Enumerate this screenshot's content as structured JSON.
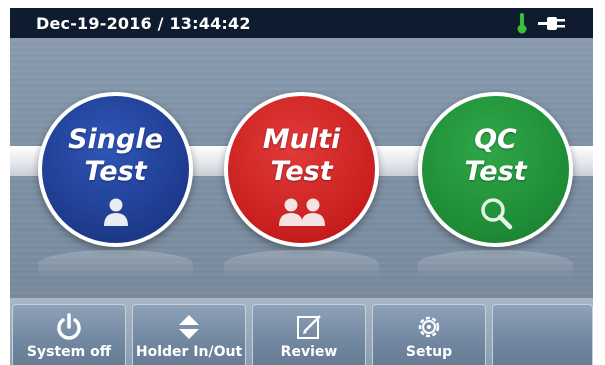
{
  "status_bar": {
    "datetime": "Dec-19-2016 / 13:44:42",
    "icons": [
      "thermometer-icon",
      "power-plug-icon"
    ],
    "thermometer_color": "#3bbf3b"
  },
  "tests": [
    {
      "line1": "Single",
      "line2": "Test",
      "icon": "person-icon",
      "color": "#1d3a8c"
    },
    {
      "line1": "Multi",
      "line2": "Test",
      "icon": "people-icon",
      "color": "#c81e1e"
    },
    {
      "line1": "QC",
      "line2": "Test",
      "icon": "magnifier-icon",
      "color": "#1e8a35"
    }
  ],
  "toolbar": {
    "buttons": [
      {
        "label": "System off",
        "icon": "power-icon"
      },
      {
        "label": "Holder In/Out",
        "icon": "up-down-arrows-icon"
      },
      {
        "label": "Review",
        "icon": "edit-document-icon"
      },
      {
        "label": "Setup",
        "icon": "gear-icon"
      },
      {
        "label": "",
        "icon": ""
      }
    ]
  }
}
